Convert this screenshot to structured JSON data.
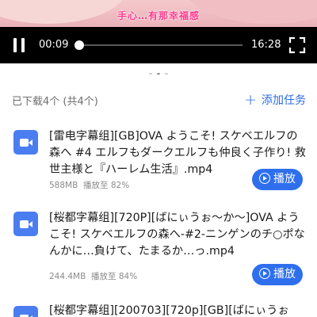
{
  "video": {
    "subtitle": "手心…有那幸福感",
    "current_time": "00:09",
    "total_time": "16:28",
    "progress": 0.01
  },
  "downloads": {
    "summary": "已下载4个 (共4个)",
    "add_task_label": "添加任务",
    "items": [
      {
        "title": "[雷电字幕组][GB]OVA ようこそ! スケベエルフの森へ #4 エルフもダークエルフも仲良く子作り! 救世主様と『ハーレム生活』.mp4",
        "size": "588MB",
        "played": "播放至 82%",
        "play_label": "播放"
      },
      {
        "title": "[桜都字幕组][720P][ばにぃうぉ～か～]OVA ようこそ! スケベエルフの森へ-#2-ニンゲンのチ○ポなんかに…負けて、たまるか…っ.mp4",
        "size": "244.4MB",
        "played": "播放至 84%",
        "play_label": "播放"
      },
      {
        "title": "[桜都字幕组][200703][720p][GB][ばにぃうぉ",
        "size": "",
        "played": "",
        "play_label": ""
      }
    ]
  },
  "colors": {
    "accent": "#2f6fee",
    "player_bg": "#000000",
    "icon_bg": "#4a7df0"
  }
}
